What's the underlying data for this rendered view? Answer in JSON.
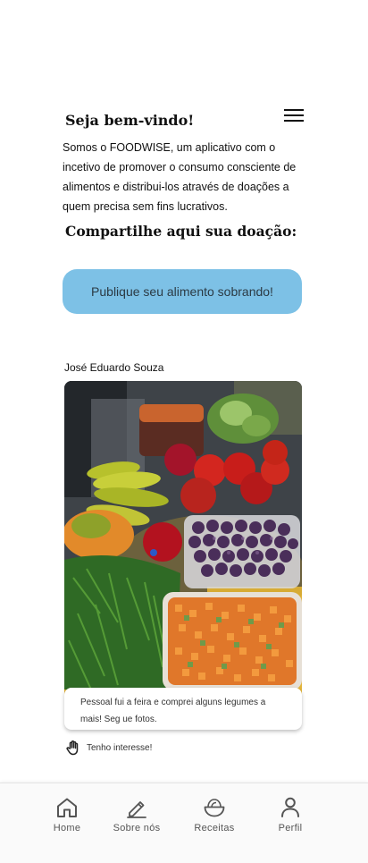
{
  "header": {
    "welcome_title": "Seja bem-vindo!",
    "menu_icon": "hamburger-menu-icon"
  },
  "intro": {
    "text": "Somos o FOODWISE, um aplicativo com o incetivo de promover o consumo consciente de alimentos e distribui-los através de doações a quem precisa sem fins lucrativos."
  },
  "donation": {
    "title": "Compartilhe aqui sua doação:",
    "publish_button": "Publique seu alimento sobrando!"
  },
  "post": {
    "author": "José Eduardo Souza",
    "caption": "Pessoal fui a feira e comprei alguns legumes a mais! Seg     ue fotos.",
    "interest_label": "Tenho interesse!",
    "interest_icon": "hand-icon"
  },
  "bottom_nav": {
    "items": [
      {
        "label": "Home",
        "icon": "home-icon"
      },
      {
        "label": "Sobre nós",
        "icon": "pencil-icon"
      },
      {
        "label": "Receitas",
        "icon": "bowl-icon"
      },
      {
        "label": "Perfil",
        "icon": "user-icon"
      }
    ]
  }
}
